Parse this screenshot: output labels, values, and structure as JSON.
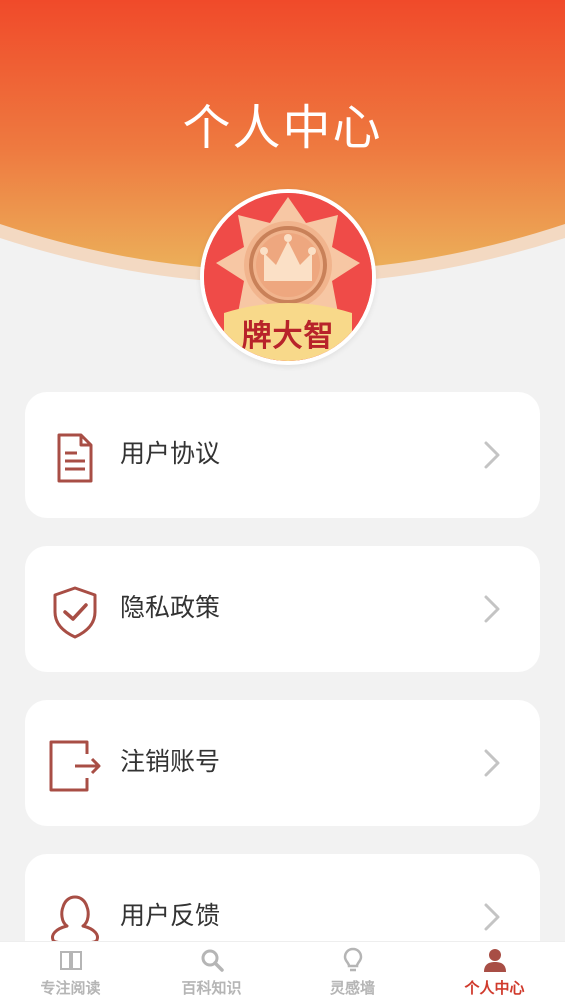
{
  "header": {
    "title": "个人中心",
    "gradient_top": "#f04a2a",
    "gradient_bottom": "#ecaa55"
  },
  "avatar": {
    "caption": "牌大智",
    "icon": "crown-badge-icon"
  },
  "menu": {
    "items": [
      {
        "label": "用户协议",
        "icon": "document-icon"
      },
      {
        "label": "隐私政策",
        "icon": "shield-check-icon"
      },
      {
        "label": "注销账号",
        "icon": "logout-icon"
      },
      {
        "label": "用户反馈",
        "icon": "user-icon"
      }
    ],
    "icon_color": "#a84e45",
    "chevron_icon": "chevron-right-icon"
  },
  "tabbar": {
    "tabs": [
      {
        "label": "专注阅读",
        "icon": "book-icon",
        "active": false
      },
      {
        "label": "百科知识",
        "icon": "search-icon",
        "active": false
      },
      {
        "label": "灵感墙",
        "icon": "bulb-icon",
        "active": false
      },
      {
        "label": "个人中心",
        "icon": "person-icon",
        "active": true
      }
    ],
    "active_color": "#d03a2c",
    "inactive_color": "#b5b5b5"
  }
}
